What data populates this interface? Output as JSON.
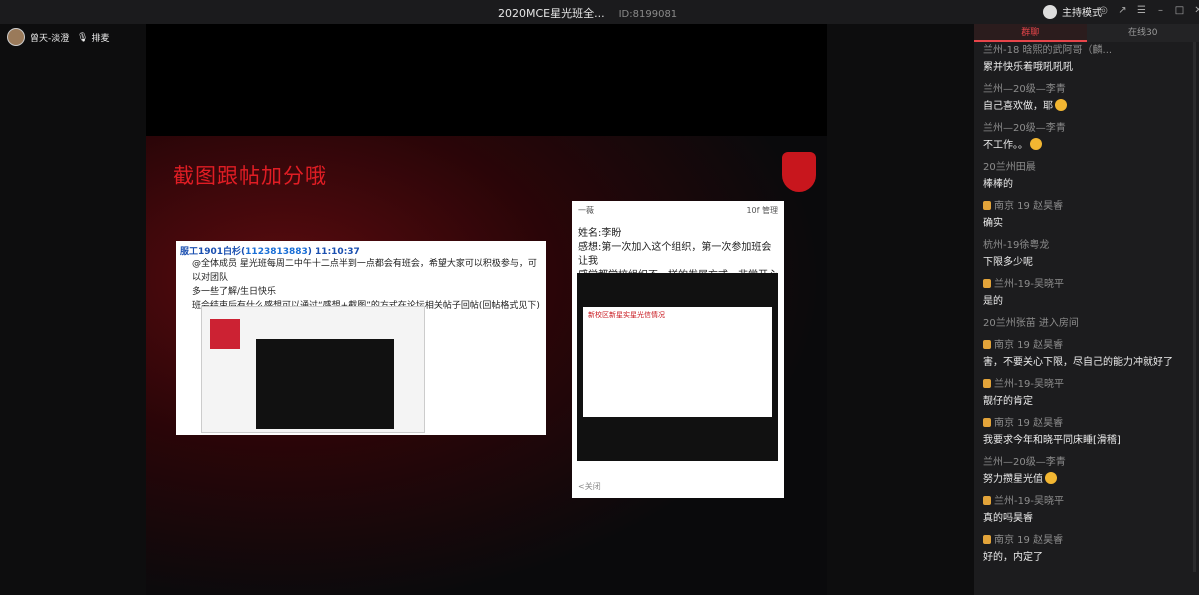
{
  "window": {
    "title": "2020MCE星光班全...",
    "room_id": "ID:8199081",
    "mode_label": "主持模式"
  },
  "user": {
    "name": "曾天-淡澄",
    "rank_label": "排麦"
  },
  "slide": {
    "title": "截图跟帖加分哦",
    "post1": {
      "header_user": "服工1901白杉(",
      "header_qq": "1123813883",
      "header_time": ") 11:10:37",
      "lines": [
        "@全体成员 星光班每周二中午十二点半到一点都会有班会，希望大家可以积极参与，可以对团队",
        "多一些了解/生日快乐",
        "班会结束后有什么感想可以通过“感想+截图”的方式在论坛相关帖子回帖(回帖格式见下)"
      ]
    },
    "post2": {
      "author": "一薇",
      "time": "10f",
      "manage": "管理",
      "lines": [
        "姓名:李盼",
        "感想:第一次加入这个组织，第一次参加班会让我",
        "感觉都学校组织不一样的发展方式，非常开心"
      ],
      "inner_title": "新校区新星实星光信情况",
      "footer": "<关闭"
    }
  },
  "chat": {
    "tabs": [
      {
        "label": "群聊",
        "active": true
      },
      {
        "label": "在线30",
        "active": false
      }
    ],
    "messages": [
      {
        "from": "兰州-18 晗熙的武阿哥（麟...",
        "text": "累并快乐着哦吼吼吼",
        "badge": false,
        "emoji": false
      },
      {
        "from": "兰州—20级—李青",
        "text": "自己喜欢做，耶",
        "badge": false,
        "emoji": true
      },
      {
        "from": "兰州—20级—李青",
        "text": "不工作。。",
        "badge": false,
        "emoji": true
      },
      {
        "from": "20兰州田晨",
        "text": "棒棒的",
        "badge": false,
        "emoji": false
      },
      {
        "from": "南京 19 赵昊睿",
        "text": "确实",
        "badge": true,
        "emoji": false
      },
      {
        "from": "杭州-19徐粤龙",
        "text": "下限多少呢",
        "badge": false,
        "emoji": false
      },
      {
        "from": "兰州-19-吴晓平",
        "text": "是的",
        "badge": true,
        "emoji": false
      },
      {
        "from": "20兰州张苗 进入房间",
        "text": "",
        "badge": false,
        "emoji": false,
        "system": true
      },
      {
        "from": "南京 19 赵昊睿",
        "text": "害，不要关心下限，尽自己的能力冲就好了",
        "badge": true,
        "emoji": false
      },
      {
        "from": "兰州-19-吴晓平",
        "text": "靓仔的肯定",
        "badge": true,
        "emoji": false
      },
      {
        "from": "南京 19 赵昊睿",
        "text": "我要求今年和晓平同床睡[滑稽]",
        "badge": true,
        "emoji": false
      },
      {
        "from": "兰州—20级—李青",
        "text": "努力攒星光值",
        "badge": false,
        "emoji": true
      },
      {
        "from": "兰州-19-吴晓平",
        "text": "真的吗昊睿",
        "badge": true,
        "emoji": false
      },
      {
        "from": "南京 19 赵昊睿",
        "text": "好的，内定了",
        "badge": true,
        "emoji": false
      }
    ]
  },
  "colors": {
    "accent": "#e8454a",
    "slide_red": "#e01d24",
    "badge": "#e3a43a"
  }
}
